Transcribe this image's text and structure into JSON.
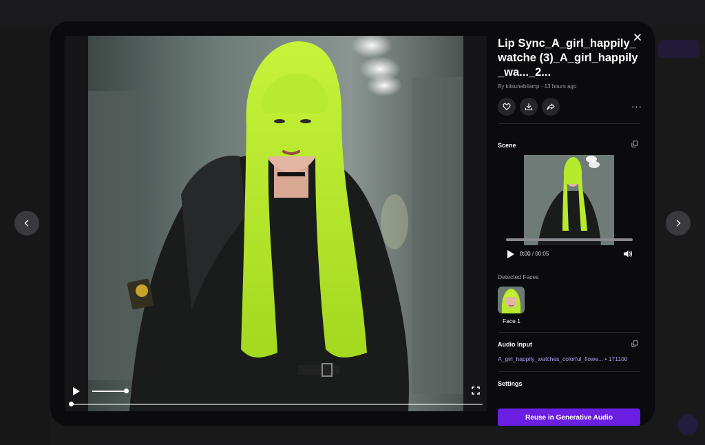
{
  "modal": {
    "title": "Lip Sync_A_girl_happily_watche (3)_A_girl_happily_wa..._2...",
    "byline": "By kitsunebilamp · 13 hours ago",
    "scene_label": "Scene",
    "scene_time_current": "0:00",
    "scene_time_total": "/ 00:05",
    "detected_faces_label": "Detected Faces",
    "face_label": "Face 1",
    "audio_input_label": "Audio Input",
    "audio_file_name": "A_girl_happily_watches_colorful_flowe...",
    "audio_file_meta": "• 171100",
    "settings_label": "Settings",
    "reuse_button": "Reuse in Generative Audio"
  },
  "icons": {
    "like": "heart-icon",
    "download": "download-icon",
    "share": "share-icon",
    "more": "more-horizontal-icon",
    "close": "close-icon",
    "copy": "copy-icon",
    "prev": "chevron-left-icon",
    "next": "chevron-right-icon"
  },
  "colors": {
    "accent": "#6a1fe2",
    "audio_link": "#a99ef0",
    "hair": "#b6ea2c"
  }
}
